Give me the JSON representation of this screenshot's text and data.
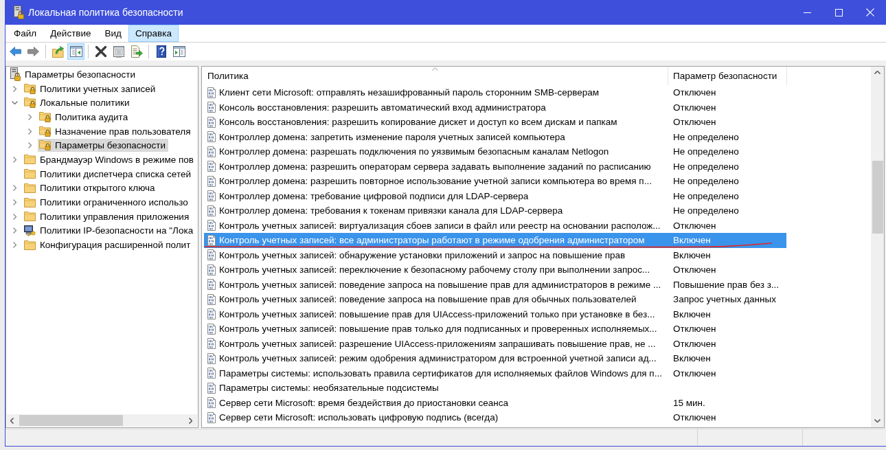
{
  "window": {
    "title": "Локальная политика безопасности"
  },
  "menu": [
    {
      "label": "Файл",
      "selected": false
    },
    {
      "label": "Действие",
      "selected": false
    },
    {
      "label": "Вид",
      "selected": false
    },
    {
      "label": "Справка",
      "selected": true
    }
  ],
  "toolbar": {
    "groups": [
      {
        "buttons": [
          {
            "kind": "back",
            "disabled": false,
            "pressed": false
          },
          {
            "kind": "forward",
            "disabled": true,
            "pressed": false
          }
        ]
      },
      {
        "buttons": [
          {
            "kind": "up",
            "disabled": false,
            "pressed": false
          },
          {
            "kind": "console-tree",
            "disabled": false,
            "pressed": true
          }
        ]
      },
      {
        "buttons": [
          {
            "kind": "delete",
            "disabled": false,
            "pressed": false
          },
          {
            "kind": "properties",
            "disabled": false,
            "pressed": false
          },
          {
            "kind": "export",
            "disabled": false,
            "pressed": false
          }
        ]
      },
      {
        "buttons": [
          {
            "kind": "help",
            "disabled": false,
            "pressed": false
          },
          {
            "kind": "action-pane",
            "disabled": false,
            "pressed": false
          }
        ]
      }
    ]
  },
  "tree": {
    "items": [
      {
        "label": "Параметры безопасности",
        "kind": "security-root",
        "selected": false,
        "children": [
          {
            "label": "Политики учетных записей",
            "kind": "locked-folder",
            "expanded": false,
            "selected": false
          },
          {
            "label": "Локальные политики",
            "kind": "locked-folder",
            "expanded": true,
            "selected": false,
            "children": [
              {
                "label": "Политика аудита",
                "kind": "locked-folder",
                "expanded": false,
                "selected": false
              },
              {
                "label": "Назначение прав пользователя",
                "kind": "locked-folder",
                "expanded": false,
                "selected": false
              },
              {
                "label": "Параметры безопасности",
                "kind": "locked-folder",
                "expanded": false,
                "selected": true
              }
            ]
          },
          {
            "label": "Брандмауэр Windows в режиме пов",
            "kind": "folder",
            "expanded": false,
            "selected": false
          },
          {
            "label": "Политики диспетчера списка сетей",
            "kind": "folder",
            "selected": false
          },
          {
            "label": "Политики открытого ключа",
            "kind": "folder",
            "expanded": false,
            "selected": false
          },
          {
            "label": "Политики ограниченного использо",
            "kind": "folder",
            "expanded": false,
            "selected": false
          },
          {
            "label": "Политики управления приложения",
            "kind": "folder",
            "expanded": false,
            "selected": false
          },
          {
            "label": "Политики IP-безопасности на \"Лока",
            "kind": "ip-security",
            "expanded": false,
            "selected": false
          },
          {
            "label": "Конфигурация расширенной полит",
            "kind": "folder",
            "expanded": false,
            "selected": false
          }
        ]
      }
    ]
  },
  "table": {
    "columns": [
      {
        "label": "Политика",
        "sorted": true
      },
      {
        "label": "Параметр безопасности",
        "sorted": false
      }
    ],
    "rows": [
      {
        "policy": "Клиент сети Microsoft: отправлять незашифрованный пароль сторонним SMB-серверам",
        "setting": "Отключен",
        "selected": false
      },
      {
        "policy": "Консоль восстановления: разрешить автоматический вход администратора",
        "setting": "Отключен",
        "selected": false
      },
      {
        "policy": "Консоль восстановления: разрешить копирование дискет и доступ ко всем дискам и папкам",
        "setting": "Отключен",
        "selected": false
      },
      {
        "policy": "Контроллер домена: запретить изменение пароля учетных записей компьютера",
        "setting": "Не определено",
        "selected": false
      },
      {
        "policy": "Контроллер домена: разрешать подключения по уязвимым безопасным каналам Netlogon",
        "setting": "Не определено",
        "selected": false
      },
      {
        "policy": "Контроллер домена: разрешить операторам сервера задавать выполнение заданий по расписанию",
        "setting": "Не определено",
        "selected": false
      },
      {
        "policy": "Контроллер домена: разрешить повторное использование учетной записи компьютера во время п...",
        "setting": "Не определено",
        "selected": false
      },
      {
        "policy": "Контроллер домена: требование цифровой подписи для LDAP-сервера",
        "setting": "Не определено",
        "selected": false
      },
      {
        "policy": "Контроллер домена: требования к токенам привязки канала для LDAP-сервера",
        "setting": "Не определено",
        "selected": false
      },
      {
        "policy": "Контроль учетных записей: виртуализация сбоев записи в файл или реестр на основании располож...",
        "setting": "Отключен",
        "selected": false
      },
      {
        "policy": "Контроль учетных записей: все администраторы работают в режиме одобрения администратором",
        "setting": "Включен",
        "selected": true
      },
      {
        "policy": "Контроль учетных записей: обнаружение установки приложений и запрос на повышение прав",
        "setting": "Включен",
        "selected": false
      },
      {
        "policy": "Контроль учетных записей: переключение к безопасному рабочему столу при выполнении запрос...",
        "setting": "Отключен",
        "selected": false
      },
      {
        "policy": "Контроль учетных записей: поведение запроса на повышение прав для администраторов в режиме ...",
        "setting": "Повышение прав без з...",
        "selected": false
      },
      {
        "policy": "Контроль учетных записей: поведение запроса на повышение прав для обычных пользователей",
        "setting": "Запрос учетных данных",
        "selected": false
      },
      {
        "policy": "Контроль учетных записей: повышение прав для UIAccess-приложений только при установке в без...",
        "setting": "Включен",
        "selected": false
      },
      {
        "policy": "Контроль учетных записей: повышение прав только для подписанных и проверенных исполняемых...",
        "setting": "Отключен",
        "selected": false
      },
      {
        "policy": "Контроль учетных записей: разрешение UIAccess-приложениям запрашивать повышение прав, не ...",
        "setting": "Отключен",
        "selected": false
      },
      {
        "policy": "Контроль учетных записей: режим одобрения администратором для встроенной учетной записи ад...",
        "setting": "Включен",
        "selected": false
      },
      {
        "policy": "Параметры системы: использовать правила сертификатов для исполняемых файлов Windows для п...",
        "setting": "Отключен",
        "selected": false
      },
      {
        "policy": "Параметры системы: необязательные подсистемы",
        "selected": false
      },
      {
        "policy": "Сервер сети Microsoft: время бездействия до приостановки сеанса",
        "setting": "15 мин.",
        "selected": false
      },
      {
        "policy": "Сервер сети Microsoft: использовать цифровую подпись (всегда)",
        "setting": "Отключен",
        "selected": false
      }
    ]
  }
}
